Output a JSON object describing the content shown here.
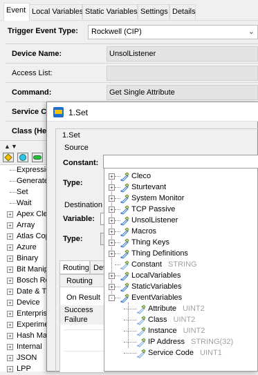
{
  "tabs": [
    {
      "label": "Event"
    },
    {
      "label": "Local Variables"
    },
    {
      "label": "Static Variables"
    },
    {
      "label": "Settings"
    },
    {
      "label": "Details"
    }
  ],
  "trigger": {
    "label": "Trigger Event Type:",
    "value": "Rockwell (CIP)"
  },
  "properties": [
    {
      "label": "Device Name:",
      "value": "UnsolListener"
    },
    {
      "label": "Access List:",
      "value": ""
    },
    {
      "label": "Command:",
      "value": "Get Single Attribute"
    },
    {
      "label": "Service C",
      "value": ""
    },
    {
      "label": "Class (He",
      "value": ""
    }
  ],
  "left_list": [
    {
      "label": "Expressio",
      "expandable": false
    },
    {
      "label": "Generate",
      "expandable": false
    },
    {
      "label": "Set",
      "expandable": false
    },
    {
      "label": "Wait",
      "expandable": false
    },
    {
      "label": "Apex Cle",
      "expandable": true
    },
    {
      "label": "Array",
      "expandable": true
    },
    {
      "label": "Atlas Cop",
      "expandable": true
    },
    {
      "label": "Azure",
      "expandable": true
    },
    {
      "label": "Binary",
      "expandable": true
    },
    {
      "label": "Bit Manip",
      "expandable": true
    },
    {
      "label": "Bosch Re",
      "expandable": true
    },
    {
      "label": "Date & Ti",
      "expandable": true
    },
    {
      "label": "Device",
      "expandable": true
    },
    {
      "label": "Enterpris",
      "expandable": true
    },
    {
      "label": "Experime",
      "expandable": true
    },
    {
      "label": "Hash Map",
      "expandable": true
    },
    {
      "label": "Internal",
      "expandable": true
    },
    {
      "label": "JSON",
      "expandable": true
    },
    {
      "label": "LPP",
      "expandable": true
    }
  ],
  "dialog": {
    "title": "1.Set",
    "group_title": "1.Set",
    "source_title": "Source",
    "constant_label": "Constant:",
    "type_label1": "Type:",
    "destination_title": "Destination",
    "variable_label": "Variable:",
    "type_label2": "Type:",
    "tab_routing": "Routing",
    "tab_other": "Det",
    "routing_header": "Routing",
    "on_result": "On Result",
    "success": "Success",
    "failure": "Failure"
  },
  "tree": [
    {
      "label": "Cleco",
      "type": "",
      "level": 0,
      "expander": "+"
    },
    {
      "label": "Sturtevant",
      "type": "",
      "level": 0,
      "expander": "+"
    },
    {
      "label": "System Monitor",
      "type": "",
      "level": 0,
      "expander": "+"
    },
    {
      "label": "TCP Passive",
      "type": "",
      "level": 0,
      "expander": "+"
    },
    {
      "label": "UnsolListener",
      "type": "",
      "level": 0,
      "expander": "+"
    },
    {
      "label": "Macros",
      "type": "",
      "level": 0,
      "expander": "+"
    },
    {
      "label": "Thing Keys",
      "type": "",
      "level": 0,
      "expander": "+"
    },
    {
      "label": "Thing Definitions",
      "type": "",
      "level": 0,
      "expander": "+"
    },
    {
      "label": "Constant",
      "type": "STRING",
      "level": 0,
      "expander": ""
    },
    {
      "label": "LocalVariables",
      "type": "",
      "level": 0,
      "expander": "+"
    },
    {
      "label": "StaticVariables",
      "type": "",
      "level": 0,
      "expander": "+"
    },
    {
      "label": "EventVariables",
      "type": "",
      "level": 0,
      "expander": "-"
    },
    {
      "label": "Attribute",
      "type": "UINT2",
      "level": 1,
      "expander": ""
    },
    {
      "label": "Class",
      "type": "UINT2",
      "level": 1,
      "expander": ""
    },
    {
      "label": "Instance",
      "type": "UINT2",
      "level": 1,
      "expander": ""
    },
    {
      "label": "IP Address",
      "type": "STRING(32)",
      "level": 1,
      "expander": ""
    },
    {
      "label": "Service Code",
      "type": "UINT1",
      "level": 1,
      "expander": ""
    }
  ]
}
